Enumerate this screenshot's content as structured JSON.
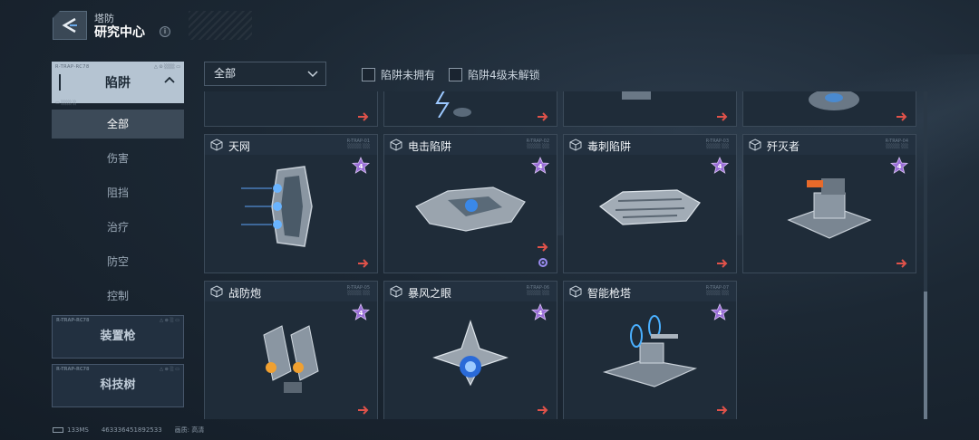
{
  "header": {
    "subtitle": "塔防",
    "title": "研究中心",
    "info": "i"
  },
  "sidebar": {
    "category": {
      "label": "陷阱",
      "tiny_left": "R-TRAP-RC78",
      "tiny_right": "△ ⊙ ░░░ ▭"
    },
    "items": [
      {
        "label": "全部",
        "active": true,
        "tiny": "▭ ░░░ ░"
      },
      {
        "label": "伤害"
      },
      {
        "label": "阻挡"
      },
      {
        "label": "治疗"
      },
      {
        "label": "防空"
      },
      {
        "label": "控制"
      }
    ],
    "collapsed": [
      {
        "label": "装置枪",
        "tiny_left": "R-TRAP-RC78",
        "tiny_right": "△ ⊙ ░ ▭"
      },
      {
        "label": "科技树",
        "tiny_left": "R-TRAP-RC78",
        "tiny_right": "△ ⊙ ░ ▭"
      }
    ]
  },
  "filter": {
    "dropdown_value": "全部",
    "checkboxes": [
      {
        "label": "陷阱未拥有"
      },
      {
        "label": "陷阱4级未解锁"
      }
    ]
  },
  "cards": [
    {
      "name": "天网",
      "level": "4",
      "serial": "R-TRAP-01\n░░░░ ░░"
    },
    {
      "name": "电击陷阱",
      "level": "4",
      "serial": "R-TRAP-02\n░░░░ ░░",
      "extra_icon": "gear-icon"
    },
    {
      "name": "毒刺陷阱",
      "level": "4",
      "serial": "R-TRAP-03\n░░░░ ░░"
    },
    {
      "name": "歼灭者",
      "level": "4",
      "serial": "R-TRAP-04\n░░░░ ░░"
    },
    {
      "name": "战防炮",
      "level": "4",
      "serial": "R-TRAP-05\n░░░░ ░░"
    },
    {
      "name": "暴风之眼",
      "level": "4",
      "serial": "R-TRAP-06\n░░░░ ░░"
    },
    {
      "name": "智能枪塔",
      "level": "4",
      "serial": "R-TRAP-07\n░░░░ ░░"
    }
  ],
  "footer": {
    "ping": "133MS",
    "uid": "463336451892533",
    "quality_label": "画质:",
    "quality": "高清"
  },
  "colors": {
    "accent_arrow": "#e0524a",
    "star": "#b98ee8",
    "panel": "#1f2c39"
  }
}
